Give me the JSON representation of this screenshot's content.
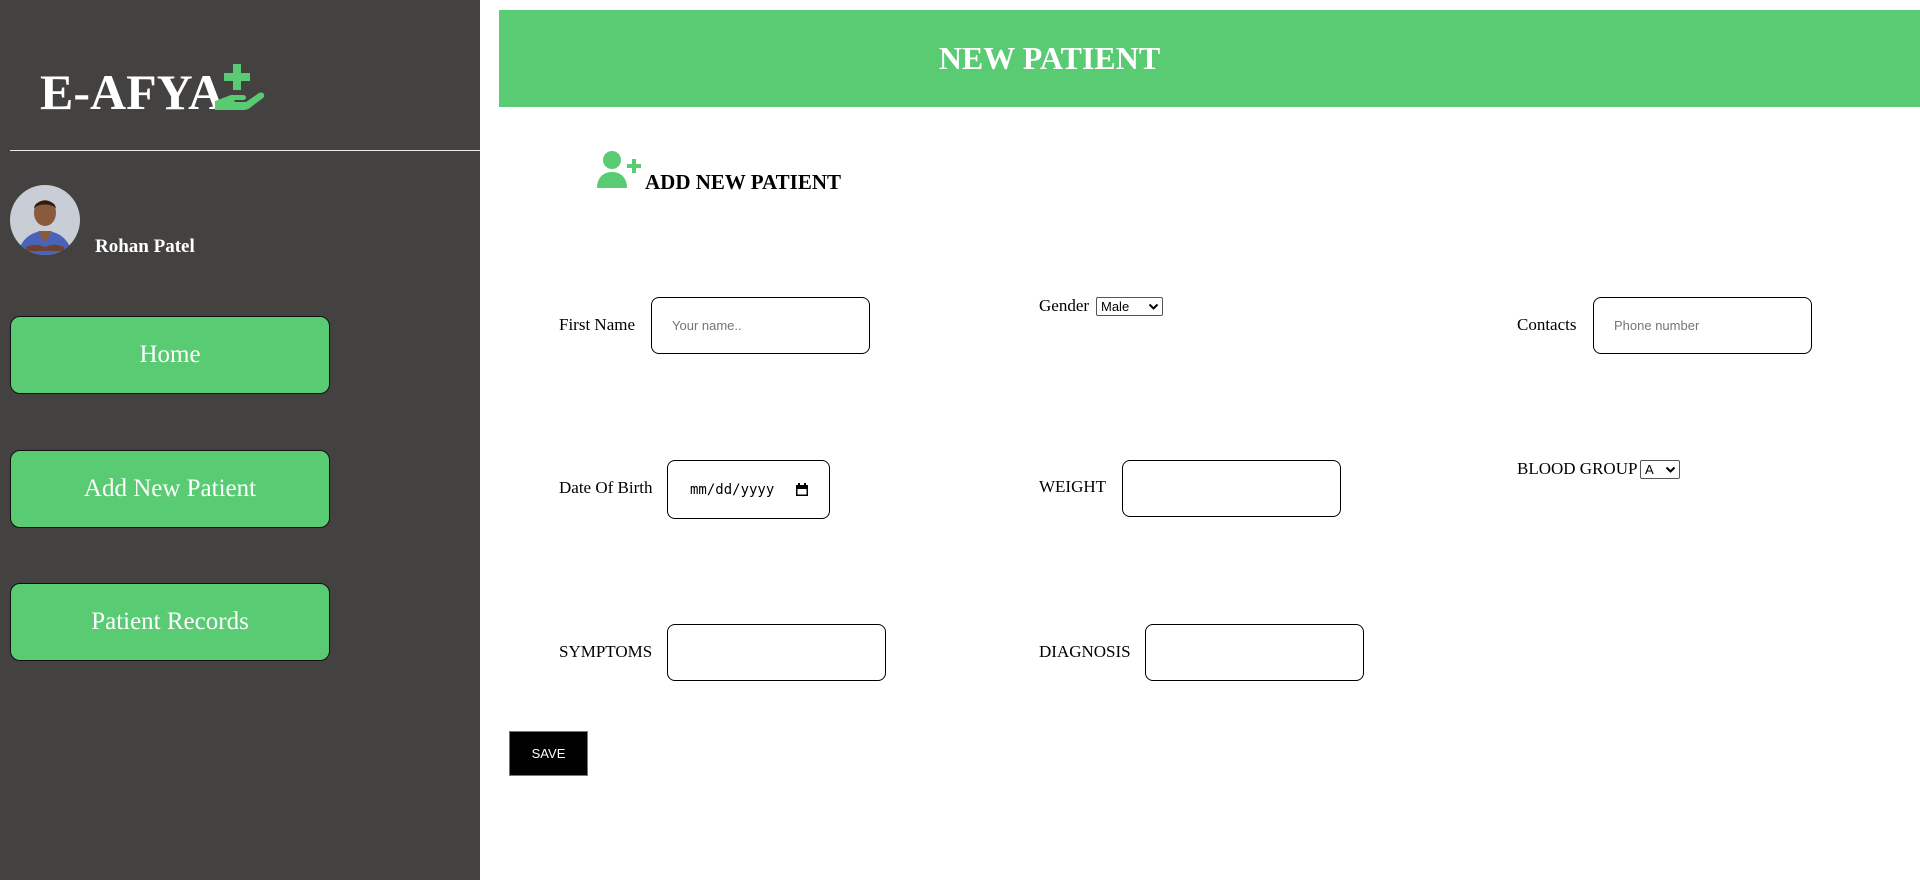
{
  "app": {
    "logo_text": "E-AFYA"
  },
  "user": {
    "name": "Rohan Patel"
  },
  "sidebar": {
    "items": [
      {
        "label": "Home"
      },
      {
        "label": "Add New Patient"
      },
      {
        "label": "Patient Records"
      }
    ]
  },
  "header": {
    "title": "NEW PATIENT"
  },
  "form": {
    "section_title": "ADD NEW PATIENT",
    "first_name": {
      "label": "First Name",
      "placeholder": "Your name..",
      "value": ""
    },
    "gender": {
      "label": "Gender",
      "selected": "Male"
    },
    "contacts": {
      "label": "Contacts",
      "placeholder": "Phone number",
      "value": ""
    },
    "dob": {
      "label": "Date Of Birth",
      "placeholder": "mm/dd/yyyy"
    },
    "weight": {
      "label": "WEIGHT",
      "value": ""
    },
    "blood_group": {
      "label": "BLOOD GROUP",
      "selected": "A"
    },
    "symptoms": {
      "label": "SYMPTOMS",
      "value": ""
    },
    "diagnosis": {
      "label": "DIAGNOSIS",
      "value": ""
    },
    "save_label": "SAVE"
  },
  "icons": {
    "logo_icon": "hand-holding-medical-icon",
    "section_icon": "user-plus-icon",
    "calendar": "calendar-icon",
    "dropdown": "chevron-down-icon"
  },
  "colors": {
    "accent": "#58cb73",
    "sidebar_bg": "#444240",
    "save_bg": "#000000"
  }
}
